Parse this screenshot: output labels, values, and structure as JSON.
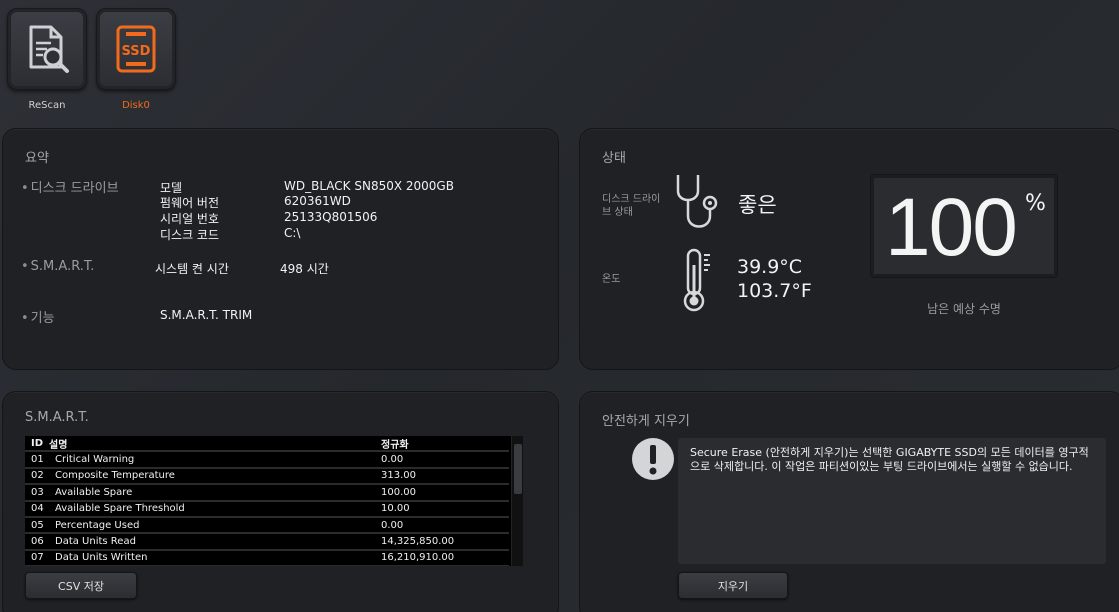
{
  "toolbar": {
    "rescan_label": "ReScan",
    "disk_label": "Disk0",
    "disk_icon_text": "SSD",
    "accent": "#f26b1d"
  },
  "summary": {
    "title": "요약",
    "disk_drive_label": "디스크 드라이브",
    "fields": [
      {
        "label": "모델",
        "value": "WD_BLACK SN850X 2000GB"
      },
      {
        "label": "펌웨어 버전",
        "value": "620361WD"
      },
      {
        "label": "시리얼 번호",
        "value": "25133Q801506"
      },
      {
        "label": "디스크 코드",
        "value": "C:\\"
      }
    ],
    "smart_label": "S.M.A.R.T.",
    "power_on_label": "시스템 켠 시간",
    "power_on_value": "498 시간",
    "features_label": "기능",
    "features_value": "S.M.A.R.T.  TRIM"
  },
  "status": {
    "title": "상태",
    "health_label": "디스크 드라이브 상태",
    "health_value": "좋은",
    "temp_label": "온도",
    "temp_c": "39.9°C",
    "temp_f": "103.7°F",
    "life_value": "100",
    "life_unit": "%",
    "life_label": "남은 예상 수명",
    "icons": [
      "stethoscope-icon",
      "thermometer-icon"
    ]
  },
  "smart": {
    "title": "S.M.A.R.T.",
    "headers": {
      "id": "ID",
      "name": "설명",
      "value": "정규화"
    },
    "rows": [
      {
        "id": "01",
        "name": "Critical Warning",
        "value": "0.00"
      },
      {
        "id": "02",
        "name": "Composite Temperature",
        "value": "313.00"
      },
      {
        "id": "03",
        "name": "Available Spare",
        "value": "100.00"
      },
      {
        "id": "04",
        "name": "Available Spare Threshold",
        "value": "10.00"
      },
      {
        "id": "05",
        "name": "Percentage Used",
        "value": "0.00"
      },
      {
        "id": "06",
        "name": "Data Units Read",
        "value": "14,325,850.00"
      },
      {
        "id": "07",
        "name": "Data Units Written",
        "value": "16,210,910.00"
      }
    ],
    "csv_button": "CSV 저장"
  },
  "erase": {
    "title": "안전하게 지우기",
    "message": "Secure Erase (안전하게 지우기)는 선택한 GIGABYTE SSD의 모든 데이터를 영구적으로 삭제합니다. 이 작업은 파티션이있는 부팅 드라이브에서는 실행할 수 없습니다.",
    "button": "지우기"
  }
}
